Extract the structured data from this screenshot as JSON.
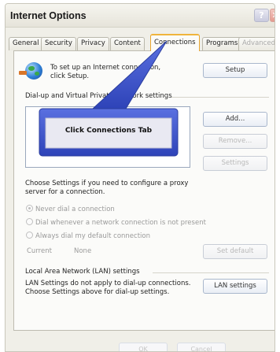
{
  "window": {
    "title": "Internet Options"
  },
  "titlebar": {
    "help_glyph": "?",
    "close_glyph": "✕"
  },
  "tabs": [
    {
      "label": "General",
      "state": "normal"
    },
    {
      "label": "Security",
      "state": "normal"
    },
    {
      "label": "Privacy",
      "state": "normal"
    },
    {
      "label": "Content",
      "state": "normal"
    },
    {
      "label": "Connections",
      "state": "active"
    },
    {
      "label": "Programs",
      "state": "normal"
    },
    {
      "label": "Advanced",
      "state": "faded"
    }
  ],
  "setup": {
    "text": "To set up an Internet connection, click Setup.",
    "button": "Setup",
    "icon": "globe-connection-icon"
  },
  "dialup": {
    "group_label": "Dial-up and Virtual Private Network settings",
    "add_button": "Add...",
    "remove_button": "Remove...",
    "settings_button": "Settings"
  },
  "proxy": {
    "text": "Choose Settings if you need to configure a proxy server for a connection.",
    "options": [
      {
        "label": "Never dial a connection",
        "checked": true
      },
      {
        "label": "Dial whenever a network connection is not present",
        "checked": false
      },
      {
        "label": "Always dial my default connection",
        "checked": false
      }
    ],
    "current_label": "Current",
    "current_value": "None",
    "set_default_button": "Set default"
  },
  "lan": {
    "group_label": "Local Area Network (LAN) settings",
    "text": "LAN Settings do not apply to dial-up connections. Choose Settings above for dial-up settings.",
    "button": "LAN settings"
  },
  "footer": {
    "ok": "OK",
    "cancel": "Cancel"
  },
  "callout": {
    "text": "Click Connections Tab",
    "fill_color": "#3d54c8",
    "arrow_color": "#4a63d8"
  },
  "colors": {
    "active_tab_border": "#f0b43c",
    "button_border": "#a9b7cc"
  }
}
